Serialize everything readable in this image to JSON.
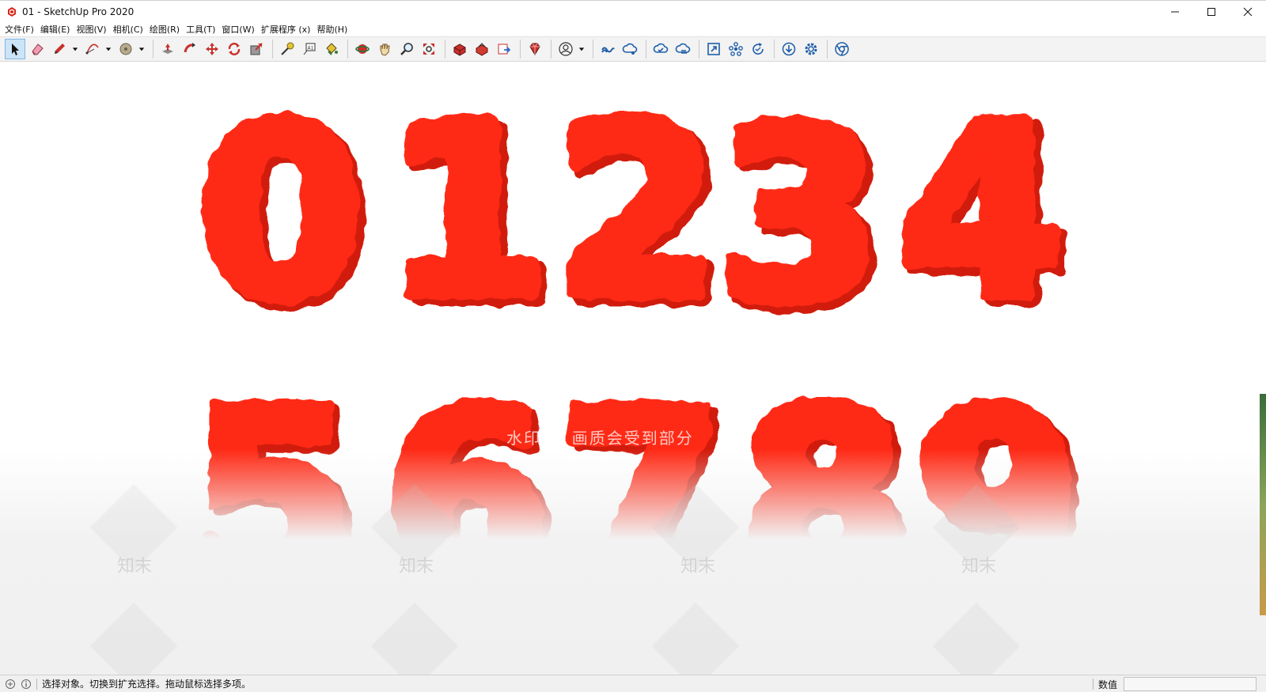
{
  "window": {
    "title": "01 - SketchUp Pro 2020"
  },
  "menu": [
    {
      "label": "文件(F)"
    },
    {
      "label": "编辑(E)"
    },
    {
      "label": "视图(V)"
    },
    {
      "label": "相机(C)"
    },
    {
      "label": "绘图(R)"
    },
    {
      "label": "工具(T)"
    },
    {
      "label": "窗口(W)"
    },
    {
      "label": "扩展程序 (x)"
    },
    {
      "label": "帮助(H)"
    }
  ],
  "toolbar": {
    "tools": [
      "select-icon",
      "eraser-icon",
      "pencil-icon",
      "arc-icon",
      "circle-icon",
      "push-pull-icon",
      "follow-me-icon",
      "move-icon",
      "rotate-icon",
      "scale-icon",
      "tape-measure-icon",
      "text-icon",
      "paint-bucket-icon",
      "orbit-icon",
      "pan-icon",
      "zoom-icon",
      "zoom-extents-icon",
      "warehouse-icon",
      "extension-warehouse-icon",
      "layout-icon",
      "ruby-icon",
      "account-icon",
      "trimble-connect-icon",
      "collaborate-icon",
      "cloud-sync-icon",
      "cloud-upload-icon",
      "zoom-window-icon",
      "components-icon",
      "refresh-icon",
      "download-icon",
      "settings-icon",
      "chrome-icon"
    ],
    "active_tool": "select-icon"
  },
  "viewport": {
    "digits": [
      "0",
      "1",
      "2",
      "3",
      "4",
      "5",
      "6",
      "7",
      "8",
      "9"
    ],
    "model_color": "#ff2a12",
    "model_shade": "#d11a08",
    "watermark": {
      "text": "水印    区    画质会受到部分",
      "logo": "知末"
    }
  },
  "statusbar": {
    "message": "选择对象。切换到扩充选择。拖动鼠标选择多项。",
    "measurements_label": "数值",
    "measurements_value": ""
  }
}
